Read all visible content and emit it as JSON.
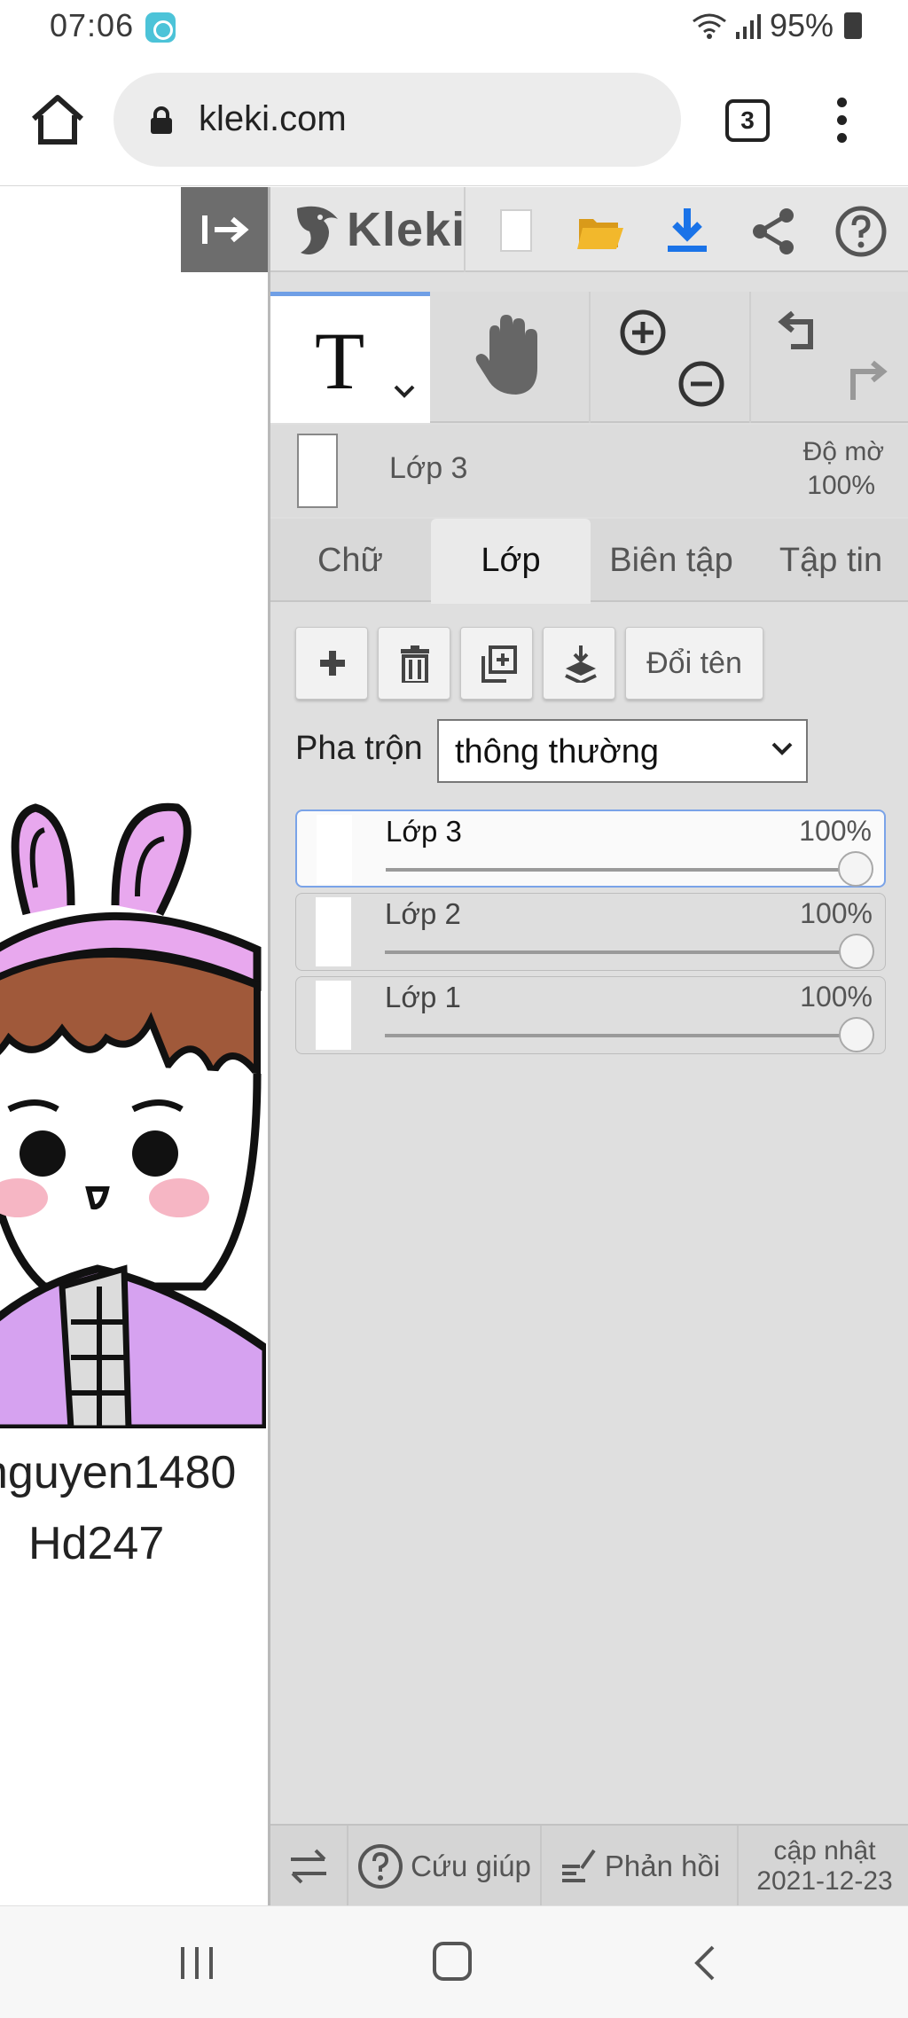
{
  "status_bar": {
    "time": "07:06",
    "battery": "95%"
  },
  "browser": {
    "url": "kleki.com",
    "tab_count": "3"
  },
  "app": {
    "logo_text": "Kleki"
  },
  "canvas": {
    "caption_line1": "nguyen1480",
    "caption_line2": "Hd247"
  },
  "layer_info": {
    "current_layer": "Lớp 3",
    "opacity_label": "Độ mờ",
    "opacity_value": "100%"
  },
  "tabs": [
    {
      "label": "Chữ",
      "active": false
    },
    {
      "label": "Lớp",
      "active": true
    },
    {
      "label": "Biên tập",
      "active": false
    },
    {
      "label": "Tập tin",
      "active": false
    }
  ],
  "layer_toolbar": {
    "rename_label": "Đổi tên"
  },
  "blend": {
    "label": "Pha trộn",
    "value": "thông thường"
  },
  "layers": [
    {
      "name": "Lớp 3",
      "opacity": "100%",
      "opacity_fraction": 1.0,
      "active": true
    },
    {
      "name": "Lớp 2",
      "opacity": "100%",
      "opacity_fraction": 1.0,
      "active": false
    },
    {
      "name": "Lớp 1",
      "opacity": "100%",
      "opacity_fraction": 1.0,
      "active": false
    }
  ],
  "bottom_bar": {
    "help_label": "Cứu giúp",
    "feedback_label": "Phản hồi",
    "update_label": "cập nhật",
    "update_date": "2021-12-23"
  },
  "colors": {
    "accent": "#6f9fe6",
    "download_blue": "#1a73e8",
    "folder_yellow": "#f2b82c",
    "panel_bg": "#dfdfdf"
  }
}
